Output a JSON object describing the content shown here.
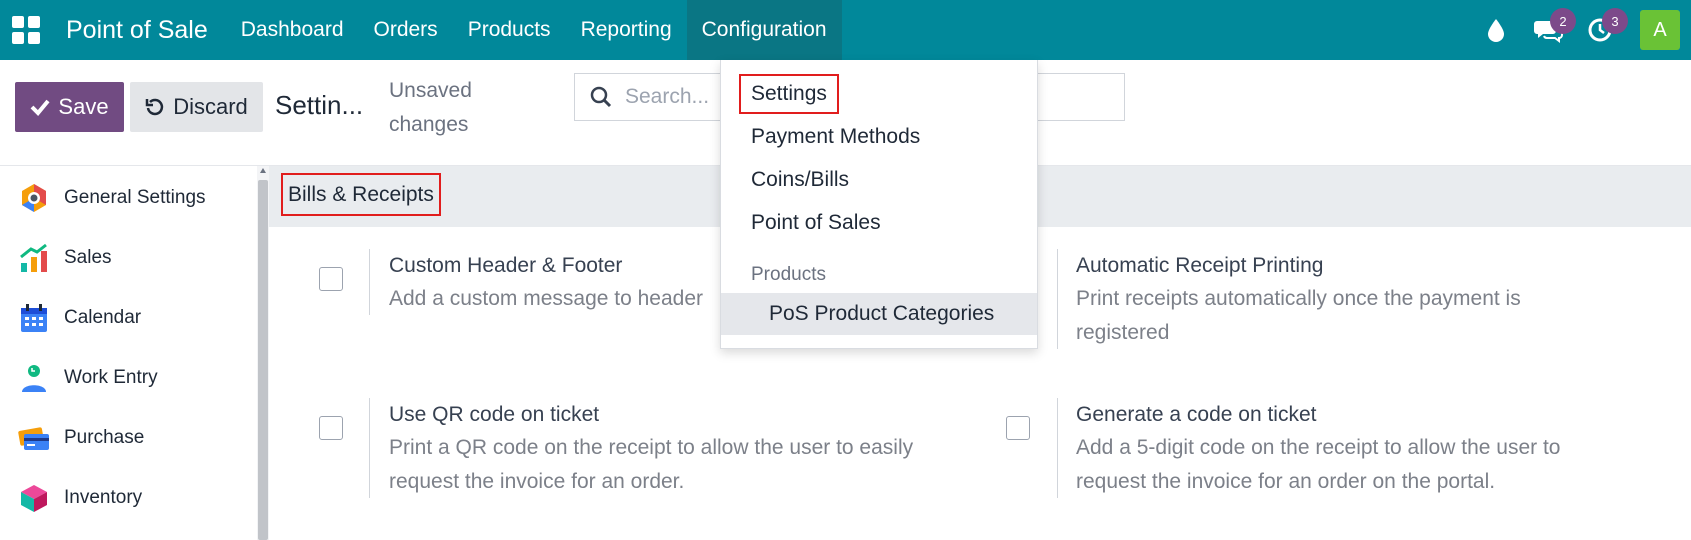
{
  "navbar": {
    "brand": "Point of Sale",
    "menu": [
      {
        "label": "Dashboard"
      },
      {
        "label": "Orders"
      },
      {
        "label": "Products"
      },
      {
        "label": "Reporting"
      },
      {
        "label": "Configuration"
      }
    ],
    "messages_count": "2",
    "activities_count": "3",
    "avatar_letter": "A"
  },
  "control": {
    "save_label": "Save",
    "discard_label": "Discard",
    "title": "Settin...",
    "unsaved_text": "Unsaved changes",
    "search_placeholder": "Search..."
  },
  "sidebar": {
    "items": [
      {
        "label": "General Settings",
        "icon": "general-settings-icon"
      },
      {
        "label": "Sales",
        "icon": "sales-icon"
      },
      {
        "label": "Calendar",
        "icon": "calendar-icon"
      },
      {
        "label": "Work Entry",
        "icon": "work-entry-icon"
      },
      {
        "label": "Purchase",
        "icon": "purchase-icon"
      },
      {
        "label": "Inventory",
        "icon": "inventory-icon"
      }
    ]
  },
  "section": {
    "title": "Bills & Receipts"
  },
  "settings": [
    {
      "title": "Custom Header & Footer",
      "desc": "Add a custom message to header"
    },
    {
      "title": "Automatic Receipt Printing",
      "desc": "Print receipts automatically once the payment is registered"
    },
    {
      "title": "Use QR code on ticket",
      "desc": "Print a QR code on the receipt to allow the user to easily request the invoice for an order."
    },
    {
      "title": "Generate a code on ticket",
      "desc": "Add a 5-digit code on the receipt to allow the user to request the invoice for an order on the portal."
    }
  ],
  "dropdown": {
    "items": [
      {
        "label": "Settings"
      },
      {
        "label": "Payment Methods"
      },
      {
        "label": "Coins/Bills"
      },
      {
        "label": "Point of Sales"
      }
    ],
    "group_header": "Products",
    "group_items": [
      {
        "label": "PoS Product Categories"
      }
    ]
  },
  "colors": {
    "navbar": "#01889a",
    "primary": "#714b82",
    "highlight": "#e11d1d"
  }
}
